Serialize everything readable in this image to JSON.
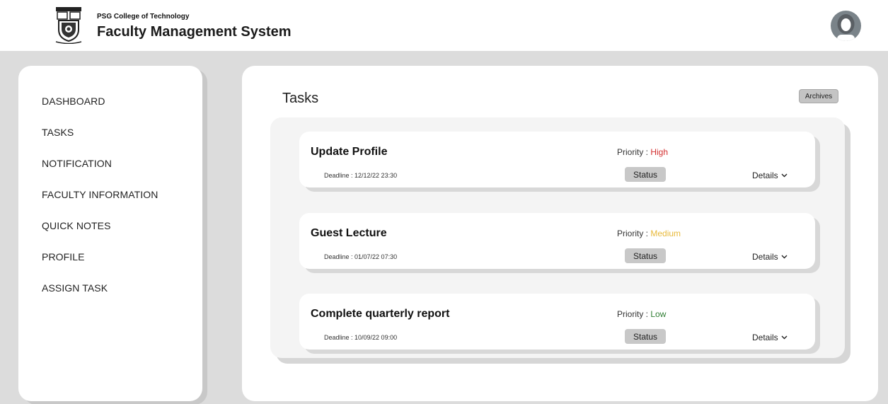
{
  "header": {
    "college": "PSG College of Technology",
    "system_name": "Faculty Management System"
  },
  "sidebar": {
    "items": [
      {
        "label": "DASHBOARD"
      },
      {
        "label": "TASKS"
      },
      {
        "label": "NOTIFICATION"
      },
      {
        "label": "FACULTY INFORMATION"
      },
      {
        "label": "QUICK NOTES"
      },
      {
        "label": "PROFILE"
      },
      {
        "label": "ASSIGN TASK"
      }
    ]
  },
  "main": {
    "title": "Tasks",
    "archives_label": "Archives",
    "tasks": [
      {
        "title": "Update Profile",
        "deadline_label": "Deadline : 12/12/22 23:30",
        "priority_label": "Priority : ",
        "priority_value": "High",
        "priority_color": "#d32f2f",
        "status_label": "Status",
        "details_label": "Details"
      },
      {
        "title": "Guest Lecture",
        "deadline_label": "Deadline : 01/07/22 07:30",
        "priority_label": "Priority : ",
        "priority_value": "Medium",
        "priority_color": "#e8b93a",
        "status_label": "Status",
        "details_label": "Details"
      },
      {
        "title": "Complete quarterly report",
        "deadline_label": "Deadline : 10/09/22 09:00",
        "priority_label": "Priority : ",
        "priority_value": "Low",
        "priority_color": "#2e7d32",
        "status_label": "Status",
        "details_label": "Details"
      }
    ]
  },
  "icons": {
    "logo": "college-crest-icon",
    "avatar": "user-avatar-icon",
    "details": "chevron-down-icon"
  }
}
